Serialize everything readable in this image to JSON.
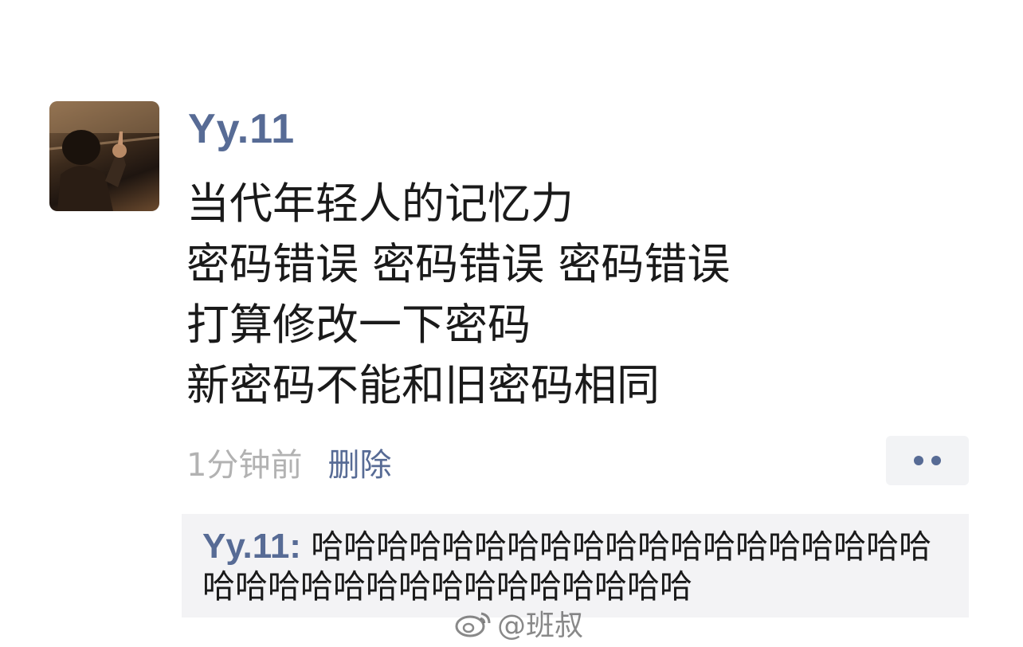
{
  "post": {
    "username": "Yy.11",
    "lines": [
      "当代年轻人的记忆力",
      "密码错误 密码错误 密码错误",
      "打算修改一下密码",
      "新密码不能和旧密码相同"
    ],
    "timestamp": "1分钟前",
    "delete_label": "删除",
    "action_icon": "more-dots-icon"
  },
  "comment": {
    "author": "Yy.11",
    "separator": ": ",
    "text": "哈哈哈哈哈哈哈哈哈哈哈哈哈哈哈哈哈哈哈哈哈哈哈哈哈哈哈哈哈哈哈哈哈哈"
  },
  "watermark": {
    "text": "@班叔",
    "icon": "weibo-logo-icon"
  },
  "colors": {
    "link_blue": "#576b95",
    "timestamp_gray": "#b2b2b2",
    "comment_bg": "#f3f3f5",
    "text_dark": "#1a1a1a"
  }
}
